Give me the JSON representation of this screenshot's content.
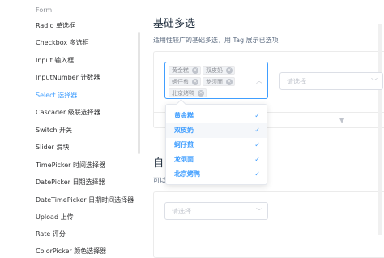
{
  "sidebar": {
    "group_label": "Form",
    "items": [
      {
        "label": "Radio 单选框",
        "active": false
      },
      {
        "label": "Checkbox 多选框",
        "active": false
      },
      {
        "label": "Input 输入框",
        "active": false
      },
      {
        "label": "InputNumber 计数器",
        "active": false
      },
      {
        "label": "Select 选择器",
        "active": true
      },
      {
        "label": "Cascader 级联选择器",
        "active": false
      },
      {
        "label": "Switch 开关",
        "active": false
      },
      {
        "label": "Slider 滑块",
        "active": false
      },
      {
        "label": "TimePicker 时间选择器",
        "active": false
      },
      {
        "label": "DatePicker 日期选择器",
        "active": false
      },
      {
        "label": "DateTimePicker 日期时间选择器",
        "active": false
      },
      {
        "label": "Upload 上传",
        "active": false
      },
      {
        "label": "Rate 评分",
        "active": false
      },
      {
        "label": "ColorPicker 颜色选择器",
        "active": false
      }
    ]
  },
  "main": {
    "title": "基础多选",
    "description": "适用性较广的基础多选，用 Tag 展示已选项",
    "next_title_partial": "自",
    "next_desc_partial": "可以",
    "multi_select": {
      "tags": [
        "黄金糕",
        "双皮奶",
        "蚵仔煎",
        "龙须面",
        "北京烤鸭"
      ],
      "arrow_icon": "chevron-up-icon"
    },
    "second_select": {
      "placeholder": "请选择"
    },
    "third_select": {
      "placeholder": "请选择"
    },
    "dropdown": {
      "options": [
        {
          "label": "黄金糕",
          "selected": true
        },
        {
          "label": "双皮奶",
          "selected": true
        },
        {
          "label": "蚵仔煎",
          "selected": true
        },
        {
          "label": "龙须面",
          "selected": true
        },
        {
          "label": "北京烤鸭",
          "selected": true
        }
      ]
    }
  },
  "colors": {
    "accent": "#409eff",
    "text": "#303133",
    "placeholder": "#c0c4cc"
  }
}
